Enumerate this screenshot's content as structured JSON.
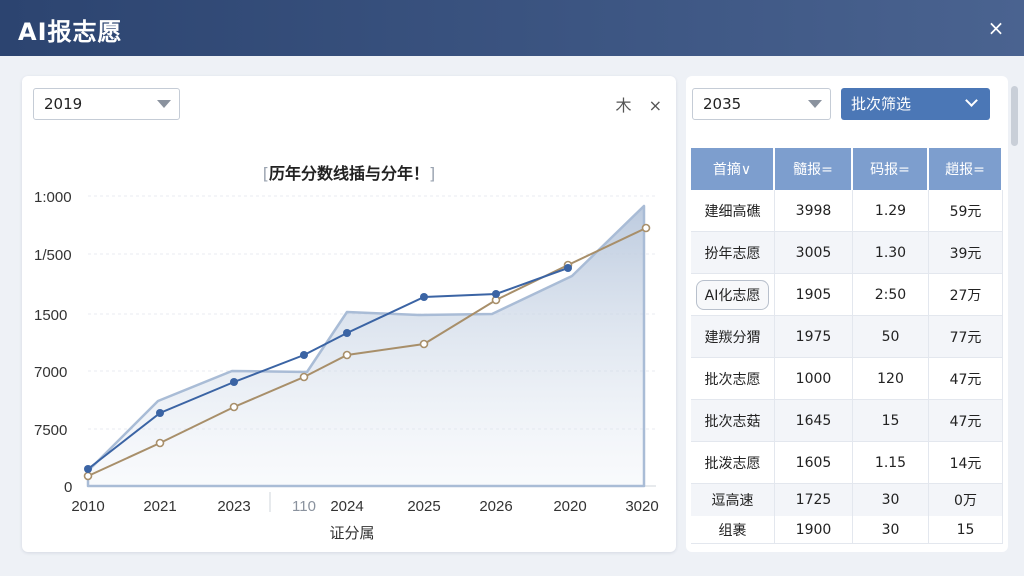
{
  "window": {
    "title": "AI报志愿",
    "close_glyph": "×"
  },
  "left_card": {
    "year_select": "2019",
    "icon_pin": "木",
    "icon_close": "×",
    "chart_title": "历年分数线插与分年！",
    "bracket_left": "[",
    "bracket_right": "]"
  },
  "chart_data": {
    "type": "line",
    "title": "历年分数线插与分年！",
    "xlabel": "证分属",
    "ylabel": "",
    "categories": [
      "2010",
      "2021",
      "2023",
      "110",
      "2024",
      "2025",
      "2026",
      "2020",
      "3020"
    ],
    "ytick_labels": [
      "0",
      "7500",
      "7000",
      "1500",
      "1/500",
      "1:000"
    ],
    "grid": true,
    "colors": {
      "series_a": "#3b64a4",
      "series_b": "#a88f6a",
      "area": "#c9d5e6"
    }
  },
  "right_panel": {
    "year_select": "2035",
    "batch_button": "批次筛选",
    "headers": [
      "首摘∨",
      "髓报=",
      "码报=",
      "趙报="
    ],
    "rows": [
      [
        "建细高礁",
        "3998",
        "1.29",
        "59元"
      ],
      [
        "扮年志愿",
        "3005",
        "1.30",
        "39元"
      ],
      [
        "AI化志愿",
        "1905",
        "2:50",
        "27万"
      ],
      [
        "建羰分猬",
        "1975",
        "50",
        "77元"
      ],
      [
        "批次志愿",
        "1000",
        "120",
        "47元"
      ],
      [
        "批次志菇",
        "1645",
        "15",
        "47元"
      ],
      [
        "批泼志愿",
        "1605",
        "1.15",
        "14元"
      ],
      [
        "逗高速",
        "1725",
        "30",
        "0万"
      ],
      [
        "组裹",
        "1900",
        "30",
        "15"
      ]
    ]
  }
}
